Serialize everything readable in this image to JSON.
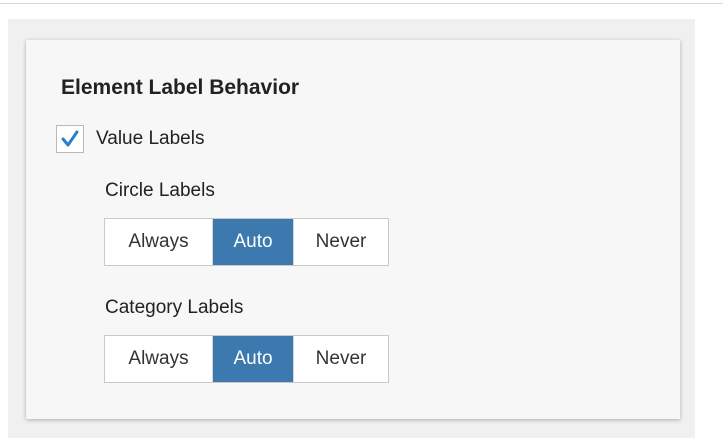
{
  "settings": {
    "section_title": "Element Label Behavior",
    "value_labels": {
      "label": "Value Labels",
      "checked": true
    },
    "circle_labels": {
      "label": "Circle Labels",
      "options": [
        "Always",
        "Auto",
        "Never"
      ],
      "selected": "Auto"
    },
    "category_labels": {
      "label": "Category Labels",
      "options": [
        "Always",
        "Auto",
        "Never"
      ],
      "selected": "Auto"
    }
  },
  "icons": {
    "checkbox": "checkmark-icon"
  },
  "colors": {
    "accent": "#3c79ae",
    "checkmark": "#2a7fc8"
  }
}
